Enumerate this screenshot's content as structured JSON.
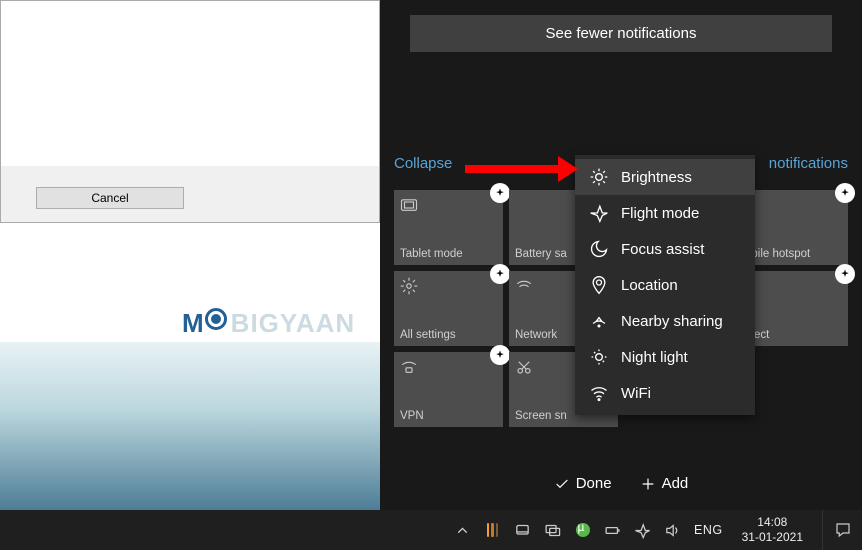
{
  "dialog": {
    "cancel": "Cancel"
  },
  "watermark": "MOBIGYAAN",
  "actionCenter": {
    "seeFewer": "See fewer notifications",
    "collapse": "Collapse",
    "clear": "notifications",
    "tiles": {
      "tabletMode": "Tablet mode",
      "batterySaver": "Battery sa",
      "mobileHotspot": "obile hotspot",
      "allSettings": "All settings",
      "network": "Network",
      "project": "oject",
      "vpn": "VPN",
      "screenSnip": "Screen sn"
    },
    "done": "Done",
    "add": "Add"
  },
  "popup": {
    "brightness": "Brightness",
    "flightMode": "Flight mode",
    "focusAssist": "Focus assist",
    "location": "Location",
    "nearbySharing": "Nearby sharing",
    "nightLight": "Night light",
    "wifi": "WiFi"
  },
  "taskbar": {
    "lang": "ENG",
    "time": "14:08",
    "date": "31-01-2021"
  }
}
